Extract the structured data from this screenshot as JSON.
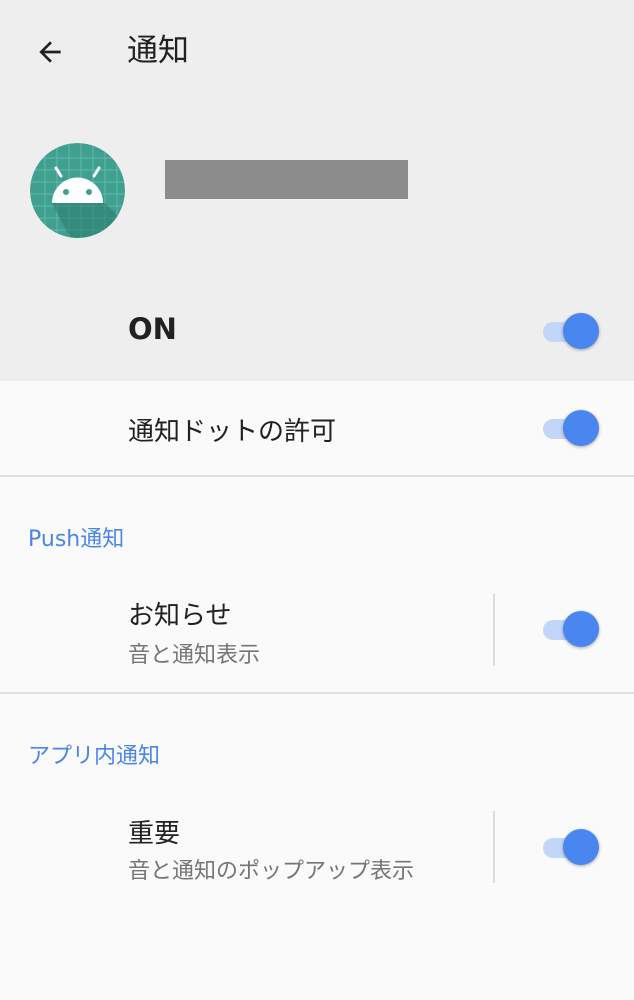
{
  "header": {
    "title": "通知",
    "back_icon": "arrow-left-icon",
    "app_icon": "android-icon",
    "app_name": ""
  },
  "main_toggle": {
    "label": "ON",
    "on": true
  },
  "notification_dot": {
    "label": "通知ドットの許可",
    "on": true
  },
  "sections": [
    {
      "label": "Push通知",
      "items": [
        {
          "title": "お知らせ",
          "subtitle": "音と通知表示",
          "on": true
        }
      ]
    },
    {
      "label": "アプリ内通知",
      "items": [
        {
          "title": "重要",
          "subtitle": "音と通知のポップアップ表示",
          "on": true
        }
      ]
    }
  ],
  "colors": {
    "accent": "#4a86f0",
    "header_bg": "#eeeeee",
    "body_bg": "#fafafa",
    "icon_bg": "#3fa08f"
  }
}
